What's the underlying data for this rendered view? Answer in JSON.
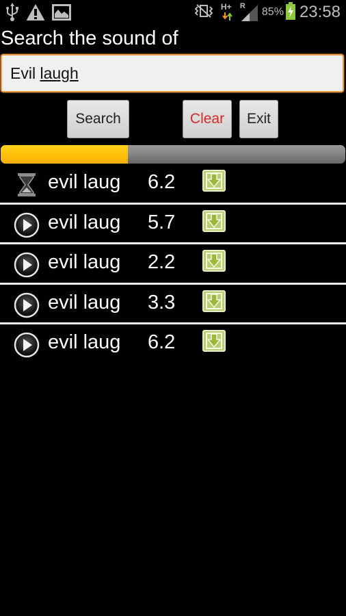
{
  "status_bar": {
    "left_icons": [
      "usb-icon",
      "warning-icon",
      "image-icon"
    ],
    "right_icons": [
      "vibrate-mute-icon",
      "network-hplus-icon",
      "roaming-icon",
      "signal-icon",
      "battery-charging-icon"
    ],
    "network_type": "H+",
    "roaming_label": "R",
    "battery_percent": "85%",
    "time": "23:58",
    "colors": {
      "icon": "#bdbdbd",
      "battery": "#8dc63f",
      "download_arrow": "#f7941d",
      "upload_arrow": "#8dc63f"
    }
  },
  "header": {
    "title": "Search the sound of"
  },
  "search": {
    "value_plain": "Evil ",
    "value_underlined": "laugh"
  },
  "buttons": {
    "search": "Search",
    "clear": "Clear",
    "exit": "Exit"
  },
  "progress": {
    "percent": 37,
    "colors": {
      "fill": "#ffc20a",
      "track": "#7a7a7a"
    }
  },
  "results": [
    {
      "status": "loading",
      "icon": "hourglass-icon",
      "name": "evil laug",
      "size": "6.2",
      "action_icon": "download-icon"
    },
    {
      "status": "ready",
      "icon": "play-icon",
      "name": "evil laug",
      "size": "5.7",
      "action_icon": "download-icon"
    },
    {
      "status": "ready",
      "icon": "play-icon",
      "name": "evil laug",
      "size": "2.2",
      "action_icon": "download-icon"
    },
    {
      "status": "ready",
      "icon": "play-icon",
      "name": "evil laug",
      "size": "3.3",
      "action_icon": "download-icon"
    },
    {
      "status": "ready",
      "icon": "play-icon",
      "name": "evil laug",
      "size": "6.2",
      "action_icon": "download-icon"
    }
  ],
  "colors": {
    "accent_border": "#f29a3a",
    "clear_text": "#d42a2a",
    "download_green": "#a8c45a"
  }
}
